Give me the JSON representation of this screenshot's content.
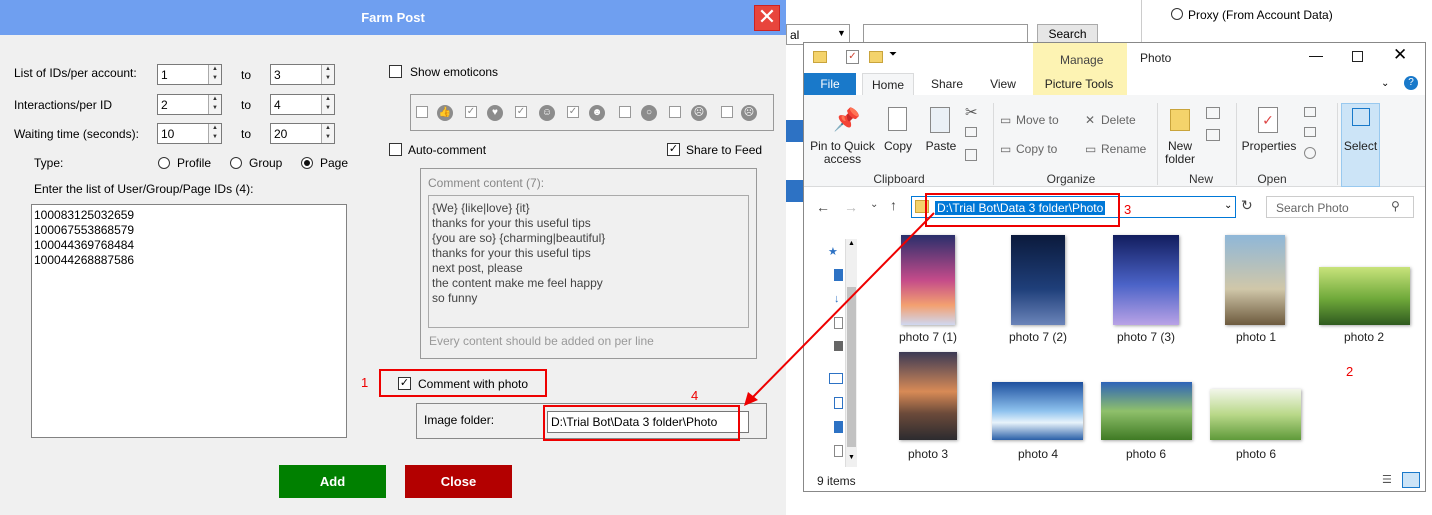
{
  "farm": {
    "title": "Farm Post",
    "close_glyph": "✕",
    "rows": [
      {
        "label": "List of IDs/per account:",
        "from": "1",
        "to": "3"
      },
      {
        "label": "Interactions/per ID",
        "from": "2",
        "to": "4"
      },
      {
        "label": "Waiting time (seconds):",
        "from": "10",
        "to": "20"
      }
    ],
    "to_label": "to",
    "type_label": "Type:",
    "type_options": [
      "Profile",
      "Group",
      "Page"
    ],
    "type_selected": "Page",
    "list_label": "Enter the list of User/Group/Page IDs (4):",
    "ids": [
      "100083125032659",
      "100067553868579",
      "100044369768484",
      "100044268887586"
    ],
    "show_emoticons": "Show emoticons",
    "auto_comment": "Auto-comment",
    "share_to_feed": "Share to Feed",
    "comment_content_label": "Comment content (7):",
    "comments": [
      "{We} {like|love} {it}",
      "thanks for your this useful tips",
      "{you are so} {charming|beautiful}",
      "thanks for your this useful tips",
      "next post, please",
      "the content make me feel happy",
      "so funny"
    ],
    "comment_hint": "Every content should be added on per line",
    "comment_with_photo": "Comment with photo",
    "image_folder_label": "Image folder:",
    "image_folder_value": "D:\\Trial Bot\\Data 3 folder\\Photo",
    "add_label": "Add",
    "close_label": "Close",
    "add_color": "#008000",
    "close_color": "#b30000"
  },
  "annotations": {
    "n1": "1",
    "n2": "2",
    "n3": "3",
    "n4": "4"
  },
  "background": {
    "dropdown_tail": "al",
    "search_label": "Search",
    "proxy_label": "Proxy (From Account Data)"
  },
  "explorer": {
    "title": "Photo",
    "manage_label": "Manage",
    "picture_tools_label": "Picture Tools",
    "tabs": [
      "File",
      "Home",
      "Share",
      "View"
    ],
    "ribbon": {
      "pin_label": "Pin to Quick access",
      "copy_label": "Copy",
      "paste_label": "Paste",
      "move_to_label": "Move to",
      "copy_to_label": "Copy to",
      "delete_label": "Delete",
      "rename_label": "Rename",
      "new_folder_label": "New folder",
      "properties_label": "Properties",
      "select_label": "Select",
      "groups": [
        "Clipboard",
        "Organize",
        "New",
        "Open"
      ]
    },
    "address": "D:\\Trial Bot\\Data 3 folder\\Photo",
    "search_placeholder": "Search Photo",
    "files": [
      "photo  7 (1)",
      "photo  7 (2)",
      "photo  7 (3)",
      "photo 1",
      "photo 2",
      "photo 3",
      "photo 4",
      "photo 6",
      "photo 6"
    ],
    "item_count": "9 items"
  }
}
